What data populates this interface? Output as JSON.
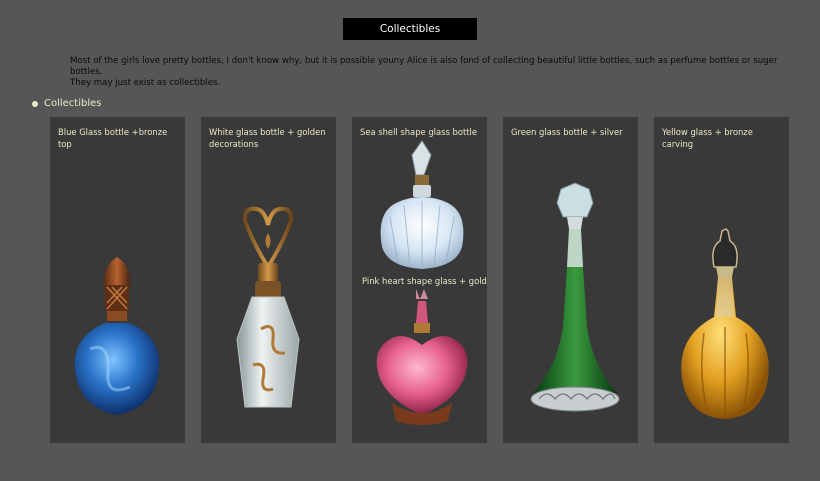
{
  "header": {
    "title": "Collectibles"
  },
  "intro": {
    "line1": "Most of the girls love pretty bottles, I don't know why, but it is possible youny Alice is also fond of collecting beautiful little bottles, such as perfume bottles or suger bottles.",
    "line2": "They may just exist as collectibles."
  },
  "section": {
    "label": "Collectibles"
  },
  "cards": [
    {
      "label": "Blue Glass bottle +bronze top",
      "icon": "blue-glass-bottle"
    },
    {
      "label": "White glass bottle + golden decorations",
      "icon": "white-glass-bottle"
    },
    {
      "label": "Sea shell shape glass bottle",
      "sub_label": "Pink heart shape glass + gold",
      "icon": "seashell-bottle"
    },
    {
      "label": "Green glass bottle + silver",
      "icon": "green-glass-bottle"
    },
    {
      "label": "Yellow glass + bronze carving",
      "icon": "yellow-glass-bottle"
    }
  ]
}
